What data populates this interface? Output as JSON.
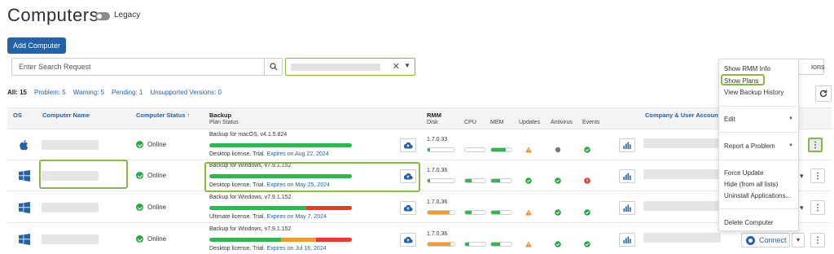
{
  "header": {
    "title": "Computers",
    "legacy_label": "Legacy"
  },
  "toolbar": {
    "add_label": "Add Computer"
  },
  "search": {
    "placeholder": "Enter Search Request",
    "options_label": "ions"
  },
  "filters": {
    "all": "All: 15",
    "problem": "Problem: 5",
    "warning": "Warning: 5",
    "pending": "Pending: 1",
    "unsupported": "Unsupported Versions: 0"
  },
  "table": {
    "headers": {
      "os": "OS",
      "name": "Computer Name",
      "status": "Computer Status ↑",
      "backup": "Backup",
      "plan_status": "Plan Status",
      "rmm": "RMM",
      "disk": "Disk",
      "cpu": "CPU",
      "mem": "MEM",
      "updates": "Updates",
      "antivirus": "Antivirus",
      "events": "Events",
      "company": "Company & User Account"
    },
    "rows": [
      {
        "os": "apple",
        "status": "Online",
        "plan": "Backup for macOS, v4.1.5.824",
        "license": "Desktop license. Trial.",
        "expires": "Expires on Aug 22, 2024",
        "plan_fill": {
          "green": 1.0,
          "orange": 0,
          "red": 0
        },
        "rmm_version": "1.7.0.33",
        "disk": 0.1,
        "cpu": 0,
        "mem": 0.7,
        "updates": "warning",
        "antivirus": "unknown",
        "events": "ok"
      },
      {
        "os": "windows",
        "status": "Online",
        "plan": "Backup for Windows, v7.9.1.152",
        "license": "Desktop license. Trial.",
        "expires": "Expires on May 25, 2024",
        "plan_fill": {
          "green": 1.0,
          "orange": 0,
          "red": 0
        },
        "rmm_version": "1.7.0.36",
        "disk": 0.1,
        "cpu": 0.3,
        "mem": 0.45,
        "updates": "ok",
        "antivirus": "ok",
        "events": "error"
      },
      {
        "os": "windows",
        "status": "Online",
        "plan": "Backup for Windows, v7.9.1.152",
        "license": "Ultimate license. Trial.",
        "expires": "Expires on May 7, 2024",
        "plan_fill": {
          "green": 0.68,
          "orange": 0,
          "red": 0.32
        },
        "rmm_version": "1.7.0.36",
        "disk": 0.82,
        "cpu": 0.3,
        "mem": 0.45,
        "updates": "warning",
        "antivirus": "ok",
        "events": "ok"
      },
      {
        "os": "windows",
        "status": "Online",
        "plan": "Backup for Windows, v7.9.1.152",
        "license": "Desktop license. Trial.",
        "expires": "Expires on Jul 16, 2024",
        "plan_fill": {
          "green": 0.5,
          "orange": 0.25,
          "red": 0.25
        },
        "rmm_version": "1.7.0.36",
        "disk": 0.85,
        "cpu": 0.2,
        "mem": 0.45,
        "updates": "warning",
        "antivirus": "ok",
        "events": "ok"
      }
    ]
  },
  "context_menu": {
    "items": [
      "Show RMM Info",
      "Show Plans",
      "View Backup History",
      "Edit",
      "Report a Problem",
      "Force Update",
      "Hide (from all lists)",
      "Uninstall Applications...",
      "Delete Computer"
    ]
  },
  "connect_label": "Connect",
  "colors": {
    "accent": "#2461a8",
    "highlight": "#8ab83e",
    "ok": "#2aa745",
    "warning": "#f0892a",
    "error": "#e03a2f",
    "bar_green": "#2db84d",
    "bar_orange": "#f39b26",
    "bar_red": "#e8392d"
  }
}
